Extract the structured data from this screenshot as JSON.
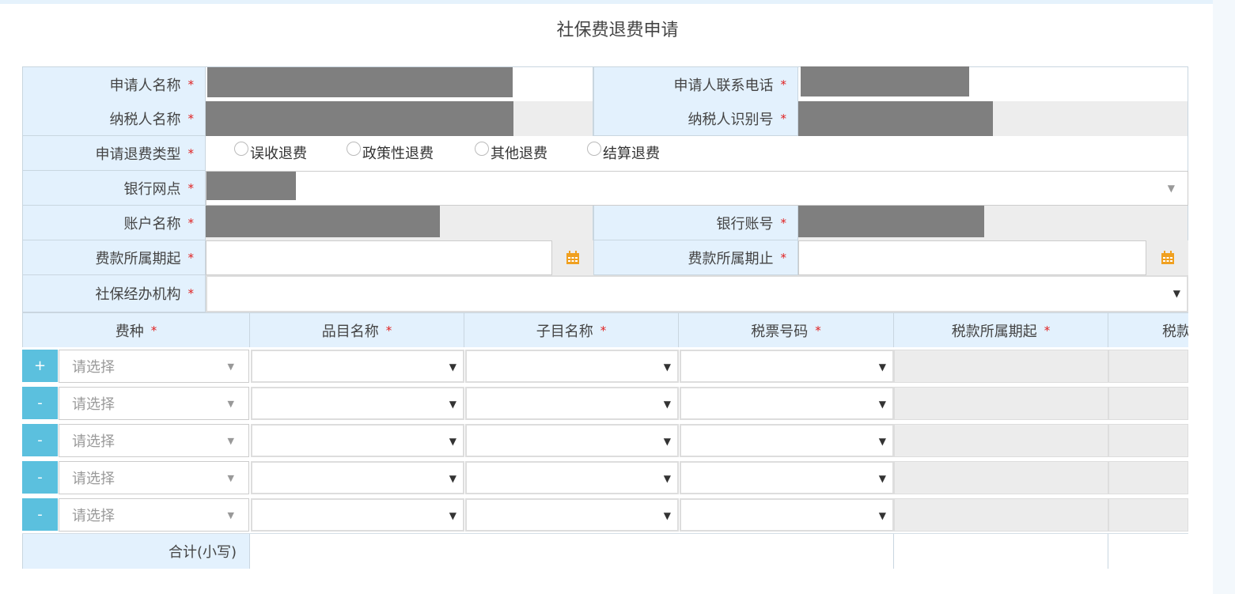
{
  "page": {
    "title": "社保费退费申请"
  },
  "colors": {
    "label_bg": "#e3f1fd",
    "accent": "#5bc0de",
    "required": "#e02020",
    "redaction": "#7f7f7f",
    "calendar_icon": "#f0a020"
  },
  "fields": {
    "applicant_name": {
      "label": "申请人名称",
      "required": "*"
    },
    "applicant_phone": {
      "label": "申请人联系电话",
      "required": "*"
    },
    "taxpayer_name": {
      "label": "纳税人名称",
      "required": "*"
    },
    "taxpayer_id": {
      "label": "纳税人识别号",
      "required": "*"
    },
    "refund_type": {
      "label": "申请退费类型",
      "required": "*",
      "options": [
        "误收退费",
        "政策性退费",
        "其他退费",
        "结算退费"
      ]
    },
    "bank_branch": {
      "label": "银行网点",
      "required": "*"
    },
    "account_name": {
      "label": "账户名称",
      "required": "*"
    },
    "bank_account": {
      "label": "银行账号",
      "required": "*"
    },
    "period_start": {
      "label": "费款所属期起",
      "required": "*"
    },
    "period_end": {
      "label": "费款所属期止",
      "required": "*"
    },
    "agency": {
      "label": "社保经办机构",
      "required": "*"
    }
  },
  "table": {
    "headers": [
      {
        "label": "费种",
        "required": "*"
      },
      {
        "label": "品目名称",
        "required": "*"
      },
      {
        "label": "子目名称",
        "required": "*"
      },
      {
        "label": "税票号码",
        "required": "*"
      },
      {
        "label": "税款所属期起",
        "required": "*"
      },
      {
        "label": "税款",
        "required": ""
      }
    ],
    "rows": [
      {
        "action": "+",
        "fee_placeholder": "请选择"
      },
      {
        "action": "-",
        "fee_placeholder": "请选择"
      },
      {
        "action": "-",
        "fee_placeholder": "请选择"
      },
      {
        "action": "-",
        "fee_placeholder": "请选择"
      },
      {
        "action": "-",
        "fee_placeholder": "请选择"
      }
    ],
    "total_label": "合计(小写)"
  },
  "icons": {
    "calendar": "calendar-icon",
    "dropdown": "chevron-down-icon"
  }
}
